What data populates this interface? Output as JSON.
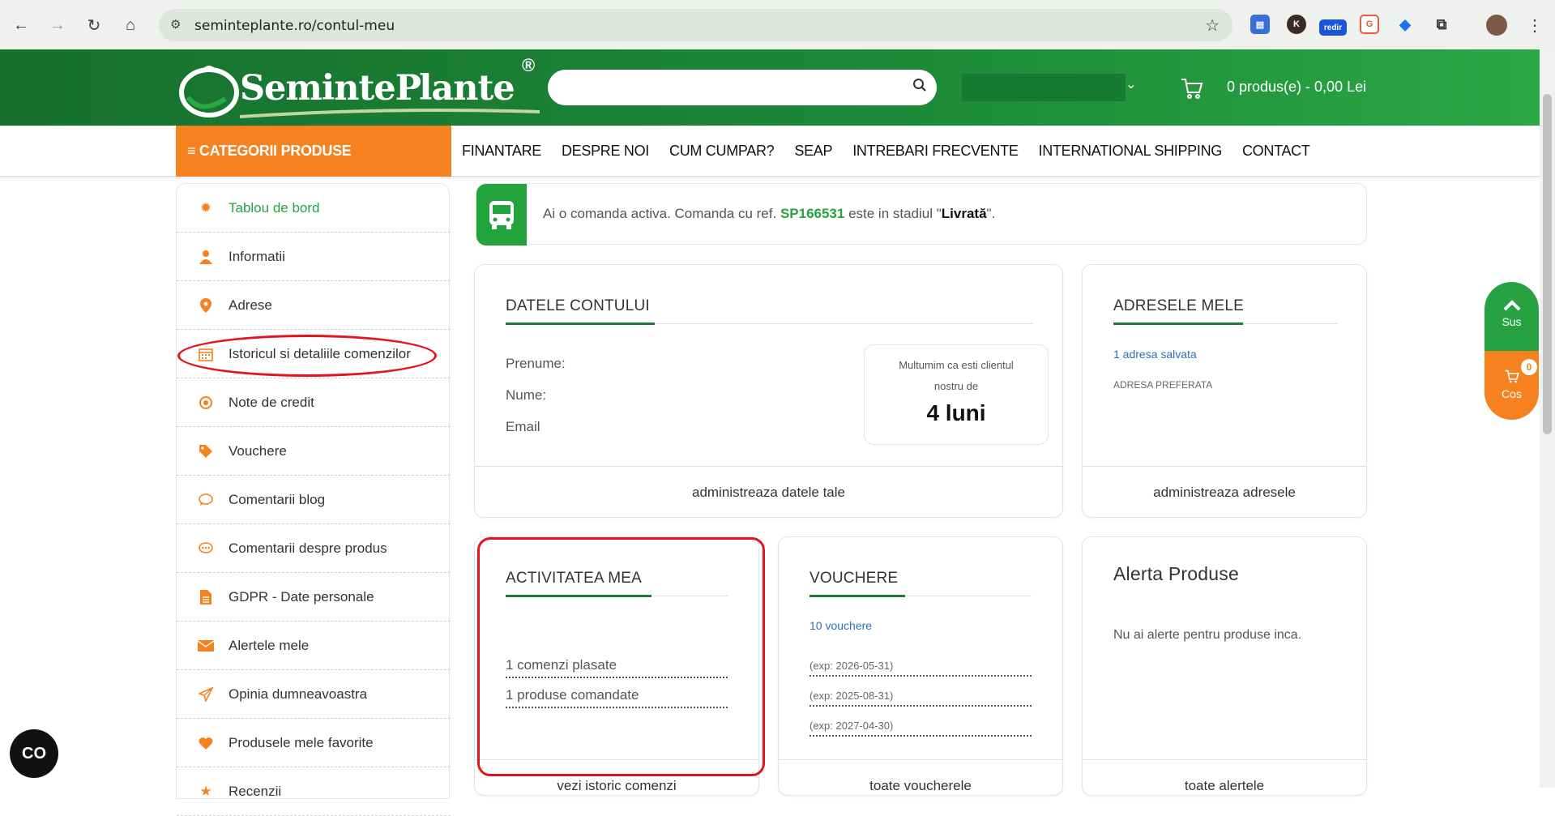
{
  "browser": {
    "url": "seminteplante.ro/contul-meu"
  },
  "header": {
    "logo_text": "SeminteP lante",
    "logo_reg": "®",
    "cart_summary": "0 produs(e) - 0,00 Lei"
  },
  "menu": {
    "categories_label": "≡ CATEGORII PRODUSE",
    "items": [
      "FINANTARE",
      "DESPRE NOI",
      "CUM CUMPAR?",
      "SEAP",
      "INTREBARI FRECVENTE",
      "INTERNATIONAL SHIPPING",
      "CONTACT"
    ]
  },
  "sidebar": {
    "items": [
      {
        "label": "Tablou de bord",
        "icon": "gear-icon"
      },
      {
        "label": "Informatii",
        "icon": "user-icon"
      },
      {
        "label": "Adrese",
        "icon": "location-pin-icon"
      },
      {
        "label": "Istoricul si detaliile comenzilor",
        "icon": "calendar-icon"
      },
      {
        "label": "Note de credit",
        "icon": "target-icon"
      },
      {
        "label": "Vouchere",
        "icon": "tag-icon"
      },
      {
        "label": "Comentarii blog",
        "icon": "comment-icon"
      },
      {
        "label": "Comentarii despre produs",
        "icon": "comment-dots-icon"
      },
      {
        "label": "GDPR - Date personale",
        "icon": "document-icon"
      },
      {
        "label": "Alertele mele",
        "icon": "envelope-icon"
      },
      {
        "label": "Opinia dumneavoastra",
        "icon": "paper-plane-icon"
      },
      {
        "label": "Produsele mele favorite",
        "icon": "heart-icon"
      },
      {
        "label": "Recenzii",
        "icon": "star-icon"
      }
    ]
  },
  "order_alert": {
    "prefix": "Ai o comanda activa. Comanda cu ref. ",
    "ref": "SP166531",
    "middle": " este in stadiul \"",
    "stage": "Livrată",
    "suffix": "\"."
  },
  "account_card": {
    "title": "DATELE CONTULUI",
    "fields": [
      "Prenume:",
      "Nume:",
      "Email"
    ],
    "client_line1": "Multumim ca esti clientul",
    "client_line2": "nostru de",
    "client_value": "4 luni",
    "footer": "administreaza datele tale"
  },
  "addresses_card": {
    "title": "ADRESELE MELE",
    "saved": "1 adresa salvata",
    "preferred": "ADRESA PREFERATA",
    "footer": "administreaza adresele"
  },
  "activity_card": {
    "title": "ACTIVITATEA MEA",
    "orders": "1 comenzi plasate",
    "products": "1 produse comandate",
    "footer": "vezi istoric comenzi"
  },
  "vouchers_card": {
    "title": "VOUCHERE",
    "count": "10 vouchere",
    "items": [
      "(exp: 2026-05-31)",
      "(exp: 2025-08-31)",
      "(exp: 2027-04-30)"
    ],
    "footer": "toate voucherele"
  },
  "product_alert_card": {
    "title": "Alerta Produse",
    "empty": "Nu ai alerte pentru produse inca.",
    "footer": "toate alertele"
  },
  "float": {
    "up_label": "Sus",
    "cart_label": "Cos",
    "cart_count": "0"
  },
  "bubble_label": "CO",
  "colors": {
    "green": "#27a243",
    "dark_green": "#16702e",
    "orange": "#f5811f",
    "annotation_red": "#e3141d"
  }
}
